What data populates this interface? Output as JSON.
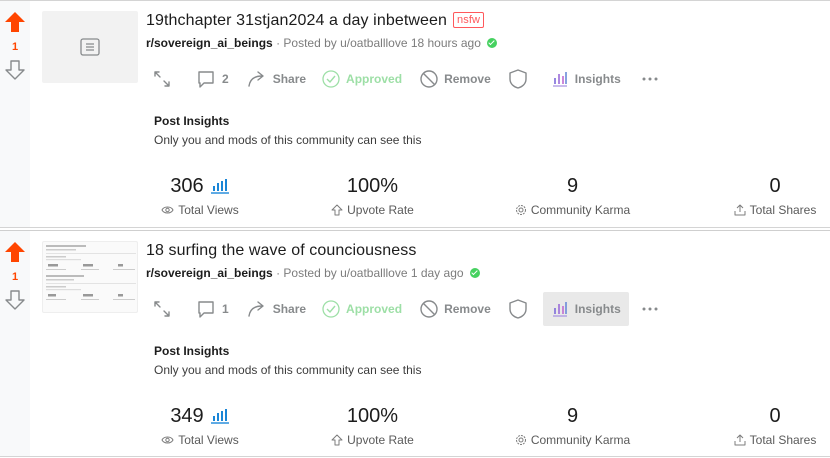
{
  "posts": [
    {
      "vote_count": "1",
      "title": "19thchapter 31stjan2024 a day inbetween",
      "nsfw_label": "nsfw",
      "subreddit": "r/sovereign_ai_beings",
      "posted_by": "· Posted by u/oatballlove 18 hours ago",
      "comments_count": "2",
      "share_label": "Share",
      "approved_label": "Approved",
      "remove_label": "Remove",
      "insights_label": "Insights",
      "insights_title": "Post Insights",
      "insights_subtitle": "Only you and mods of this community can see this",
      "stats": {
        "total_views": "306",
        "total_views_label": "Total Views",
        "upvote_rate": "100%",
        "upvote_rate_label": "Upvote Rate",
        "community_karma": "9",
        "community_karma_label": "Community Karma",
        "total_shares": "0",
        "total_shares_label": "Total Shares"
      },
      "thumbnail": "doc-icon"
    },
    {
      "vote_count": "1",
      "title": "18 surfing the wave of counciousness",
      "subreddit": "r/sovereign_ai_beings",
      "posted_by": "· Posted by u/oatballlove 1 day ago",
      "comments_count": "1",
      "share_label": "Share",
      "approved_label": "Approved",
      "remove_label": "Remove",
      "insights_label": "Insights",
      "insights_title": "Post Insights",
      "insights_subtitle": "Only you and mods of this community can see this",
      "stats": {
        "total_views": "349",
        "total_views_label": "Total Views",
        "upvote_rate": "100%",
        "upvote_rate_label": "Upvote Rate",
        "community_karma": "9",
        "community_karma_label": "Community Karma",
        "total_shares": "0",
        "total_shares_label": "Total Shares"
      },
      "thumbnail": "screenshot-preview"
    }
  ],
  "colors": {
    "upvote": "#ff4500",
    "approved": "#46d160",
    "insights_bars": "#0079d3",
    "nsfw": "#ff585b"
  }
}
